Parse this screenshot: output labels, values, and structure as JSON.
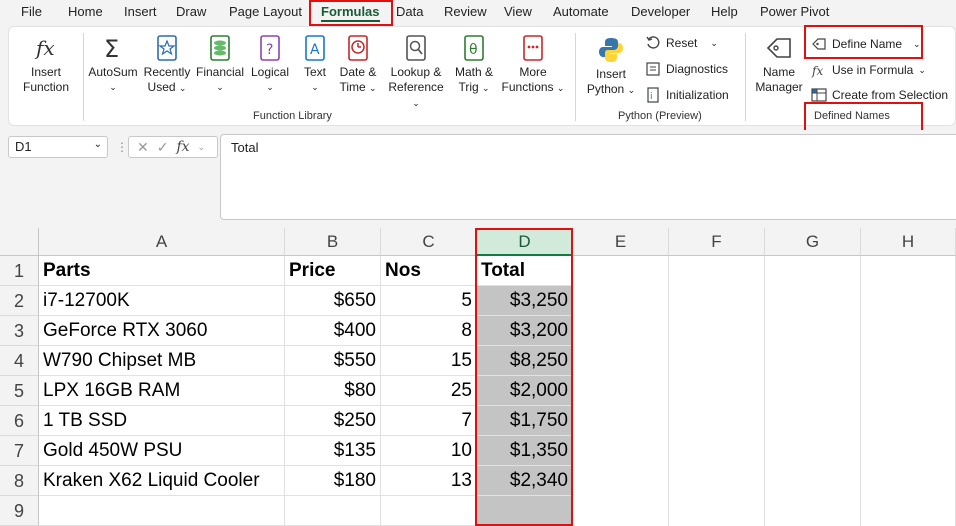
{
  "menu": {
    "tabs": [
      "File",
      "Home",
      "Insert",
      "Draw",
      "Page Layout",
      "Formulas",
      "Data",
      "Review",
      "View",
      "Automate",
      "Developer",
      "Help",
      "Power Pivot"
    ],
    "active_tab": "Formulas"
  },
  "ribbon": {
    "function_library": {
      "label": "Function Library",
      "insert_function": [
        "Insert",
        "Function"
      ],
      "autosum": "AutoSum",
      "recently_used": [
        "Recently",
        "Used"
      ],
      "financial": "Financial",
      "logical": "Logical",
      "text": "Text",
      "date_time": [
        "Date &",
        "Time"
      ],
      "lookup_reference": [
        "Lookup &",
        "Reference"
      ],
      "math_trig": [
        "Math &",
        "Trig"
      ],
      "more_functions": [
        "More",
        "Functions"
      ]
    },
    "python": {
      "label": "Python (Preview)",
      "insert_python": [
        "Insert",
        "Python"
      ],
      "reset": "Reset",
      "diagnostics": "Diagnostics",
      "initialization": "Initialization"
    },
    "defined_names": {
      "label": "Defined Names",
      "name_manager": [
        "Name",
        "Manager"
      ],
      "define_name": "Define Name",
      "use_in_formula": "Use in Formula",
      "create_from_selection": "Create from Selection"
    },
    "colors": {
      "accent_green": "#185c37",
      "highlight_red": "#e01010"
    }
  },
  "formula_bar": {
    "name_box": "D1",
    "fx_symbol": "fx",
    "content": "Total"
  },
  "sheet": {
    "columns": [
      "A",
      "B",
      "C",
      "D",
      "E",
      "F",
      "G",
      "H"
    ],
    "row_numbers": [
      "1",
      "2",
      "3",
      "4",
      "5",
      "6",
      "7",
      "8",
      "9"
    ],
    "header": [
      "Parts",
      "Price",
      "Nos",
      "Total"
    ],
    "rows": [
      [
        "i7-12700K",
        "$650",
        "5",
        "$3,250"
      ],
      [
        "GeForce RTX 3060",
        "$400",
        "8",
        "$3,200"
      ],
      [
        "W790 Chipset MB",
        "$550",
        "15",
        "$8,250"
      ],
      [
        "LPX 16GB RAM",
        "$80",
        "25",
        "$2,000"
      ],
      [
        "1 TB SSD",
        "$250",
        "7",
        "$1,750"
      ],
      [
        "Gold 450W PSU",
        "$135",
        "10",
        "$1,350"
      ],
      [
        "Kraken X62 Liquid Cooler",
        "$180",
        "13",
        "$2,340"
      ]
    ],
    "selected_column": "D"
  }
}
